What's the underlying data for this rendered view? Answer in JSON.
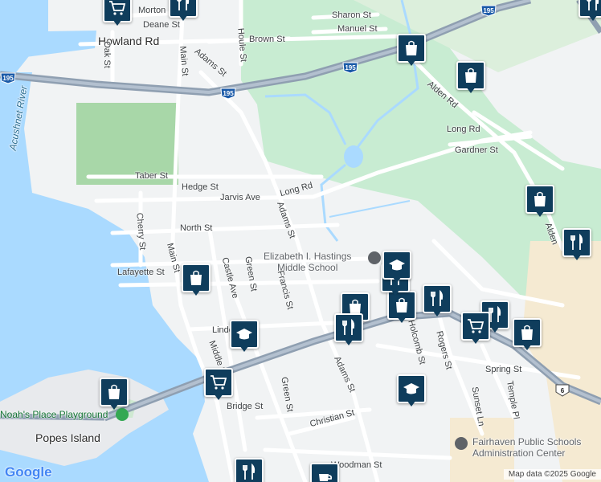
{
  "map": {
    "colors": {
      "water": "#aadaff",
      "land": "#f1f3f4",
      "park": "#c8ecd2",
      "cemetery": "#a8d7a8",
      "highway": "#8f9fb1",
      "road": "#ffffff",
      "pin": "#0f3d5c",
      "school_grounds": "#f5ead2"
    },
    "labels": {
      "morton": "Morton",
      "deane": "Deane St",
      "sharon": "Sharon St",
      "manuel": "Manuel St",
      "brown": "Brown St",
      "howland": "Howland Rd",
      "oak": "Oak St",
      "main_top": "Main St",
      "adams_top": "Adams St",
      "houle": "Houle St",
      "acushnet": "Acushnet River",
      "alden_rd": "Alden Rd",
      "long_rd_e": "Long Rd",
      "gardner": "Gardner St",
      "taber": "Taber St",
      "hedge": "Hedge St",
      "jarvis": "Jarvis Ave",
      "long_rd": "Long Rd",
      "adams_mid": "Adams St",
      "cherry": "Cherry St",
      "north": "North St",
      "alden_e": "Alden",
      "school_name_line1": "Elizabeth I. Hastings",
      "school_name_line2": "Middle School",
      "lafayette": "Lafayette St",
      "main_mid": "Main St",
      "castle": "Castle Ave",
      "green_mid": "Green St",
      "francis": "Francis St",
      "linden": "Linden Ave",
      "holcomb": "Holcomb St",
      "rogers": "Rogers St",
      "adams_low": "Adams St",
      "spring": "Spring St",
      "sunset": "Sunset Ln",
      "temple": "Temple Pl",
      "green_low": "Green St",
      "bridge": "Bridge St",
      "middle": "Middle St",
      "christian": "Christian St",
      "playground": "Noah's Place Playground",
      "popes": "Popes Island",
      "admin_line1": "Fairhaven Public Schools",
      "admin_line2": "Administration Center",
      "woodman": "Woodman St"
    },
    "shields": [
      {
        "name": "i195-shield-top",
        "text": "195"
      },
      {
        "name": "i195-shield-mid",
        "text": "195"
      },
      {
        "name": "i195-shield-left",
        "text": "195"
      },
      {
        "name": "i195-shield-west",
        "text": "195"
      },
      {
        "name": "us6-shield",
        "text": "6"
      }
    ],
    "google": "Google",
    "attribution": "Map data ©2025 Google"
  }
}
